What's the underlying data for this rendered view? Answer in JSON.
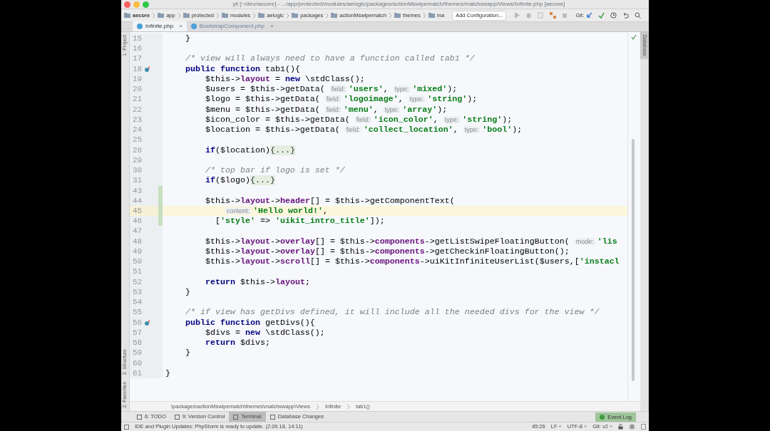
{
  "window": {
    "title": "yii [~/dev/aecore] - .../app/protected/modules/aelogic/packages/actionMswipematch/themes/matchswapp/Views/Infinite.php [aecore]"
  },
  "nav_bar": {
    "breadcrumbs": [
      "aecore",
      "app",
      "protected",
      "modules",
      "aelogic",
      "packages",
      "actionMswipematch",
      "themes",
      "ma"
    ],
    "run_config": "Add Configuration...",
    "git_label": "Git:"
  },
  "tabs": [
    {
      "label": "Infinite.php",
      "close": "×",
      "selected": true
    },
    {
      "label": "BootstrapComponent.php",
      "close": "×",
      "selected": false
    }
  ],
  "left_tools": [
    "1: Project",
    "2: Structure",
    "2: Favorites"
  ],
  "right_tools": [
    "Database"
  ],
  "editor": {
    "lines": [
      {
        "n": "15",
        "kind": "code",
        "current": false,
        "changed": false,
        "override": false,
        "tokens": [
          {
            "kind": "plain",
            "text": "    }"
          }
        ]
      },
      {
        "n": "16",
        "kind": "code",
        "current": false,
        "changed": false,
        "override": false
      },
      {
        "n": "17",
        "kind": "code",
        "current": false,
        "changed": false,
        "override": false,
        "tokens": [
          {
            "kind": "comment",
            "text": "    /* view will always need to have a function called tab1 */"
          }
        ]
      },
      {
        "n": "18",
        "kind": "code",
        "current": false,
        "changed": false,
        "override": true,
        "tokens": [
          {
            "kind": "keyword",
            "text": "    public function "
          },
          {
            "kind": "plain",
            "text": "tab1(){"
          }
        ]
      },
      {
        "n": "19",
        "kind": "code",
        "current": false,
        "changed": false,
        "override": false,
        "tokens": [
          {
            "kind": "plain",
            "text": "        $this->"
          },
          {
            "kind": "field",
            "text": "layout"
          },
          {
            "kind": "plain",
            "text": " = "
          },
          {
            "kind": "keyword",
            "text": "new "
          },
          {
            "kind": "plain",
            "text": "\\stdClass();"
          }
        ]
      },
      {
        "n": "20",
        "kind": "code",
        "current": false,
        "changed": false,
        "override": false,
        "tokens": [
          {
            "kind": "plain",
            "text": "        $users = $this->getData( "
          },
          {
            "kind": "hint",
            "text": "field:"
          },
          {
            "kind": "string",
            "text": "'users'"
          },
          {
            "kind": "plain",
            "text": ", "
          },
          {
            "kind": "hint",
            "text": "type:"
          },
          {
            "kind": "string",
            "text": "'mixed'"
          },
          {
            "kind": "plain",
            "text": ");"
          }
        ]
      },
      {
        "n": "21",
        "kind": "code",
        "current": false,
        "changed": false,
        "override": false,
        "tokens": [
          {
            "kind": "plain",
            "text": "        $logo = $this->getData( "
          },
          {
            "kind": "hint",
            "text": "field:"
          },
          {
            "kind": "string",
            "text": "'logoimage'"
          },
          {
            "kind": "plain",
            "text": ", "
          },
          {
            "kind": "hint",
            "text": "type:"
          },
          {
            "kind": "string",
            "text": "'string'"
          },
          {
            "kind": "plain",
            "text": ");"
          }
        ]
      },
      {
        "n": "22",
        "kind": "code",
        "current": false,
        "changed": false,
        "override": false,
        "tokens": [
          {
            "kind": "plain",
            "text": "        $menu = $this->getData( "
          },
          {
            "kind": "hint",
            "text": "field:"
          },
          {
            "kind": "string",
            "text": "'menu'"
          },
          {
            "kind": "plain",
            "text": ", "
          },
          {
            "kind": "hint",
            "text": "type:"
          },
          {
            "kind": "string",
            "text": "'array'"
          },
          {
            "kind": "plain",
            "text": ");"
          }
        ]
      },
      {
        "n": "23",
        "kind": "code",
        "current": false,
        "changed": false,
        "override": false,
        "tokens": [
          {
            "kind": "plain",
            "text": "        $icon_color = $this->getData( "
          },
          {
            "kind": "hint",
            "text": "field:"
          },
          {
            "kind": "string",
            "text": "'icon_color'"
          },
          {
            "kind": "plain",
            "text": ", "
          },
          {
            "kind": "hint",
            "text": "type:"
          },
          {
            "kind": "string",
            "text": "'string'"
          },
          {
            "kind": "plain",
            "text": ");"
          }
        ]
      },
      {
        "n": "24",
        "kind": "code",
        "current": false,
        "changed": false,
        "override": false,
        "tokens": [
          {
            "kind": "plain",
            "text": "        $location = $this->getData( "
          },
          {
            "kind": "hint",
            "text": "field:"
          },
          {
            "kind": "string",
            "text": "'collect_location'"
          },
          {
            "kind": "plain",
            "text": ", "
          },
          {
            "kind": "hint",
            "text": "type:"
          },
          {
            "kind": "string",
            "text": "'bool'"
          },
          {
            "kind": "plain",
            "text": ");"
          }
        ]
      },
      {
        "n": "25",
        "kind": "code",
        "current": false,
        "changed": false,
        "override": false
      },
      {
        "n": "26",
        "kind": "code",
        "current": false,
        "changed": false,
        "override": false,
        "tokens": [
          {
            "kind": "keyword",
            "text": "        if"
          },
          {
            "kind": "plain",
            "text": "($location)"
          },
          {
            "kind": "fold",
            "text": "{...}"
          }
        ]
      },
      {
        "n": "29",
        "kind": "code",
        "current": false,
        "changed": false,
        "override": false
      },
      {
        "n": "30",
        "kind": "code",
        "current": false,
        "changed": false,
        "override": false,
        "tokens": [
          {
            "kind": "comment",
            "text": "        /* top bar if logo is set */"
          }
        ]
      },
      {
        "n": "31",
        "kind": "code",
        "current": false,
        "changed": false,
        "override": false,
        "tokens": [
          {
            "kind": "keyword",
            "text": "        if"
          },
          {
            "kind": "plain",
            "text": "($logo)"
          },
          {
            "kind": "fold",
            "text": "{...}"
          }
        ]
      },
      {
        "n": "43",
        "kind": "code",
        "current": false,
        "changed": true,
        "override": false
      },
      {
        "n": "44",
        "kind": "code",
        "current": false,
        "changed": true,
        "override": false,
        "tokens": [
          {
            "kind": "plain",
            "text": "        $this->"
          },
          {
            "kind": "field",
            "text": "layout"
          },
          {
            "kind": "plain",
            "text": "->"
          },
          {
            "kind": "field",
            "text": "header"
          },
          {
            "kind": "plain",
            "text": "[] = $this->getComponentText("
          }
        ]
      },
      {
        "n": "45",
        "kind": "continuation",
        "current": true,
        "changed": true,
        "override": false,
        "tokens": [
          {
            "kind": "hint",
            "text": "content:"
          },
          {
            "kind": "string",
            "text": "'Hello world!'"
          },
          {
            "kind": "plain",
            "text": ","
          }
        ]
      },
      {
        "n": "46",
        "kind": "code",
        "current": false,
        "changed": true,
        "override": false,
        "tokens": [
          {
            "kind": "plain",
            "text": "          ["
          },
          {
            "kind": "string",
            "text": "'style'"
          },
          {
            "kind": "plain",
            "text": " => "
          },
          {
            "kind": "string",
            "text": "'uikit_intro_title'"
          },
          {
            "kind": "plain",
            "text": "]);"
          }
        ]
      },
      {
        "n": "47",
        "kind": "code",
        "current": false,
        "changed": false,
        "override": false
      },
      {
        "n": "48",
        "kind": "code",
        "current": false,
        "changed": false,
        "override": false,
        "tokens": [
          {
            "kind": "plain",
            "text": "        $this->"
          },
          {
            "kind": "field",
            "text": "layout"
          },
          {
            "kind": "plain",
            "text": "->"
          },
          {
            "kind": "field",
            "text": "overlay"
          },
          {
            "kind": "plain",
            "text": "[] = $this->"
          },
          {
            "kind": "field",
            "text": "components"
          },
          {
            "kind": "plain",
            "text": "->getListSwipeFloatingButton( "
          },
          {
            "kind": "hint",
            "text": "mode:"
          },
          {
            "kind": "string",
            "text": "'lis"
          }
        ]
      },
      {
        "n": "49",
        "kind": "code",
        "current": false,
        "changed": false,
        "override": false,
        "tokens": [
          {
            "kind": "plain",
            "text": "        $this->"
          },
          {
            "kind": "field",
            "text": "layout"
          },
          {
            "kind": "plain",
            "text": "->"
          },
          {
            "kind": "field",
            "text": "overlay"
          },
          {
            "kind": "plain",
            "text": "[] = $this->"
          },
          {
            "kind": "field",
            "text": "components"
          },
          {
            "kind": "plain",
            "text": "->getCheckinFloatingButton();"
          }
        ]
      },
      {
        "n": "50",
        "kind": "code",
        "current": false,
        "changed": false,
        "override": false,
        "tokens": [
          {
            "kind": "plain",
            "text": "        $this->"
          },
          {
            "kind": "field",
            "text": "layout"
          },
          {
            "kind": "plain",
            "text": "->"
          },
          {
            "kind": "field",
            "text": "scroll"
          },
          {
            "kind": "plain",
            "text": "[] = $this->"
          },
          {
            "kind": "field",
            "text": "components"
          },
          {
            "kind": "plain",
            "text": "->uiKitInfiniteUserList($users,["
          },
          {
            "kind": "string",
            "text": "'instacl"
          }
        ]
      },
      {
        "n": "51",
        "kind": "code",
        "current": false,
        "changed": false,
        "override": false
      },
      {
        "n": "52",
        "kind": "code",
        "current": false,
        "changed": false,
        "override": false,
        "tokens": [
          {
            "kind": "keyword",
            "text": "        return "
          },
          {
            "kind": "plain",
            "text": "$this->"
          },
          {
            "kind": "field",
            "text": "layout"
          },
          {
            "kind": "plain",
            "text": ";"
          }
        ]
      },
      {
        "n": "53",
        "kind": "code",
        "current": false,
        "changed": false,
        "override": false,
        "tokens": [
          {
            "kind": "plain",
            "text": "    }"
          }
        ]
      },
      {
        "n": "54",
        "kind": "code",
        "current": false,
        "changed": false,
        "override": false
      },
      {
        "n": "55",
        "kind": "code",
        "current": false,
        "changed": false,
        "override": false,
        "tokens": [
          {
            "kind": "comment",
            "text": "    /* if view has getDivs defined, it will include all the needed divs for the view */"
          }
        ]
      },
      {
        "n": "56",
        "kind": "code",
        "current": false,
        "changed": false,
        "override": true,
        "tokens": [
          {
            "kind": "keyword",
            "text": "    public function "
          },
          {
            "kind": "plain",
            "text": "getDivs(){"
          }
        ]
      },
      {
        "n": "57",
        "kind": "code",
        "current": false,
        "changed": false,
        "override": false,
        "tokens": [
          {
            "kind": "plain",
            "text": "        $divs = "
          },
          {
            "kind": "keyword",
            "text": "new "
          },
          {
            "kind": "plain",
            "text": "\\stdClass();"
          }
        ]
      },
      {
        "n": "58",
        "kind": "code",
        "current": false,
        "changed": false,
        "override": false,
        "tokens": [
          {
            "kind": "keyword",
            "text": "        return "
          },
          {
            "kind": "plain",
            "text": "$divs;"
          }
        ]
      },
      {
        "n": "59",
        "kind": "code",
        "current": false,
        "changed": false,
        "override": false,
        "tokens": [
          {
            "kind": "plain",
            "text": "    }"
          }
        ]
      },
      {
        "n": "60",
        "kind": "code",
        "current": false,
        "changed": false,
        "override": false
      },
      {
        "n": "61",
        "kind": "code",
        "current": false,
        "changed": false,
        "override": false,
        "tokens": [
          {
            "kind": "plain",
            "text": "}"
          }
        ]
      }
    ]
  },
  "code_breadcrumbs": [
    "\\packages\\actionMswipematch\\themes\\matchswapp\\Views",
    "Infinite",
    "tab1()"
  ],
  "tool_windows": [
    {
      "label": "6: TODO",
      "selected": false
    },
    {
      "label": "9: Version Control",
      "selected": false
    },
    {
      "label": "Terminal",
      "selected": true
    },
    {
      "label": "Database Changes",
      "selected": false
    }
  ],
  "event_log": "Event Log",
  "status_bar": {
    "message": "IDE and Plugin Updates: PhpStorm is ready to update. (2.09.18, 14:11)",
    "position": "45:26",
    "line_sep": "LF ÷",
    "encoding": "UTF-8 ÷",
    "git": "Git: v2 ÷"
  }
}
